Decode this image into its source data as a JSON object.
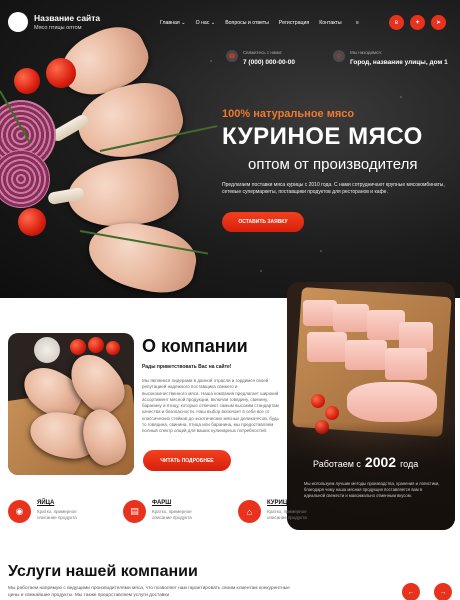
{
  "header": {
    "site_title": "Название сайта",
    "site_subtitle": "Мясо птицы оптом",
    "nav": [
      {
        "label": "Главная",
        "has_dropdown": true
      },
      {
        "label": "О нас",
        "has_dropdown": true
      },
      {
        "label": "Вопросы и ответы",
        "has_dropdown": false
      },
      {
        "label": "Регистрация",
        "has_dropdown": false
      },
      {
        "label": "Контакты",
        "has_dropdown": false
      }
    ],
    "menu_icon": "hamburger-menu-icon",
    "social": [
      "vk-icon",
      "twitter-icon",
      "telegram-icon"
    ]
  },
  "contacts": {
    "phone_label": "Свяжитесь с нами:",
    "phone": "7 (000) 000-00-00",
    "address_label": "Мы находимся:",
    "address": "Город, название улицы, дом 1"
  },
  "hero": {
    "tagline": "100% натуральное мясо",
    "headline": "КУРИНОЕ МЯСО",
    "subheadline": "оптом от производителя",
    "description": "Предлагаем поставки мяса курицы с 2010 года. С нами сотрудничают крупные мясокомбинаты, сетевые супермаркеты, поставщики продуктов для ресторанов и кафе.",
    "cta_label": "ОСТАВИТЬ ЗАЯВКУ"
  },
  "about": {
    "title": "О компании",
    "lead": "Рады приветствовать Вас на сайте!",
    "body": "Мы являемся лидерами в данной отрасли и гордимся своей репутацией надежного поставщика свежего и высококачественного мяса. Наша компания предлагает широкий ассортимент мясной продукции, включая говядину, свинину, баранину и птицу, которые отвечают самым высоким стандартам качества и безопасности. Наш выбор включает в себя все от классических стейков до экзотических мясных деликатесов, будь то говядина, свинина, птица или баранина, мы предоставляем полный спектр опций для ваших кулинарных потребностей.",
    "cta_label": "ЧИТАТЬ ПОДРОБНЕЕ",
    "since_prefix": "Работаем с",
    "since_year": "2002",
    "since_suffix": "года",
    "since_desc": "Мы используем лучшие методы производства, хранения и логистики, благодаря чему наша мясная продукция поставляется вам в идеальной свежести и максимально отменным вкусом."
  },
  "features": [
    {
      "name": "ЯЙЦА",
      "desc": "Кратко, примерное описание продукта",
      "icon": "eggs-icon"
    },
    {
      "name": "ФАРШ",
      "desc": "Кратко, примерное описание продукта",
      "icon": "mince-icon"
    },
    {
      "name": "КУРИЦА",
      "desc": "Кратко, примерное описание продукта",
      "icon": "chicken-icon"
    }
  ],
  "services": {
    "title": "Услуги нашей компании",
    "desc": "Мы работаем напрямую с ведущими производителями мяса, что позволяет нам гарантировать своим клиентам конкурентные цены и свежайшие продукты. Мы также предоставляем услуги доставки"
  },
  "colors": {
    "accent": "#e8321e",
    "orange": "#f07a2c"
  }
}
